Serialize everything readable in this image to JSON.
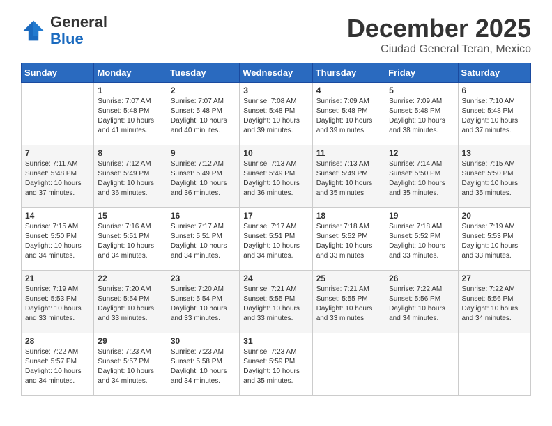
{
  "header": {
    "logo_general": "General",
    "logo_blue": "Blue",
    "month": "December 2025",
    "location": "Ciudad General Teran, Mexico"
  },
  "days_of_week": [
    "Sunday",
    "Monday",
    "Tuesday",
    "Wednesday",
    "Thursday",
    "Friday",
    "Saturday"
  ],
  "weeks": [
    [
      {
        "day": "",
        "info": ""
      },
      {
        "day": "1",
        "info": "Sunrise: 7:07 AM\nSunset: 5:48 PM\nDaylight: 10 hours\nand 41 minutes."
      },
      {
        "day": "2",
        "info": "Sunrise: 7:07 AM\nSunset: 5:48 PM\nDaylight: 10 hours\nand 40 minutes."
      },
      {
        "day": "3",
        "info": "Sunrise: 7:08 AM\nSunset: 5:48 PM\nDaylight: 10 hours\nand 39 minutes."
      },
      {
        "day": "4",
        "info": "Sunrise: 7:09 AM\nSunset: 5:48 PM\nDaylight: 10 hours\nand 39 minutes."
      },
      {
        "day": "5",
        "info": "Sunrise: 7:09 AM\nSunset: 5:48 PM\nDaylight: 10 hours\nand 38 minutes."
      },
      {
        "day": "6",
        "info": "Sunrise: 7:10 AM\nSunset: 5:48 PM\nDaylight: 10 hours\nand 37 minutes."
      }
    ],
    [
      {
        "day": "7",
        "info": "Sunrise: 7:11 AM\nSunset: 5:48 PM\nDaylight: 10 hours\nand 37 minutes."
      },
      {
        "day": "8",
        "info": "Sunrise: 7:12 AM\nSunset: 5:49 PM\nDaylight: 10 hours\nand 36 minutes."
      },
      {
        "day": "9",
        "info": "Sunrise: 7:12 AM\nSunset: 5:49 PM\nDaylight: 10 hours\nand 36 minutes."
      },
      {
        "day": "10",
        "info": "Sunrise: 7:13 AM\nSunset: 5:49 PM\nDaylight: 10 hours\nand 36 minutes."
      },
      {
        "day": "11",
        "info": "Sunrise: 7:13 AM\nSunset: 5:49 PM\nDaylight: 10 hours\nand 35 minutes."
      },
      {
        "day": "12",
        "info": "Sunrise: 7:14 AM\nSunset: 5:50 PM\nDaylight: 10 hours\nand 35 minutes."
      },
      {
        "day": "13",
        "info": "Sunrise: 7:15 AM\nSunset: 5:50 PM\nDaylight: 10 hours\nand 35 minutes."
      }
    ],
    [
      {
        "day": "14",
        "info": "Sunrise: 7:15 AM\nSunset: 5:50 PM\nDaylight: 10 hours\nand 34 minutes."
      },
      {
        "day": "15",
        "info": "Sunrise: 7:16 AM\nSunset: 5:51 PM\nDaylight: 10 hours\nand 34 minutes."
      },
      {
        "day": "16",
        "info": "Sunrise: 7:17 AM\nSunset: 5:51 PM\nDaylight: 10 hours\nand 34 minutes."
      },
      {
        "day": "17",
        "info": "Sunrise: 7:17 AM\nSunset: 5:51 PM\nDaylight: 10 hours\nand 34 minutes."
      },
      {
        "day": "18",
        "info": "Sunrise: 7:18 AM\nSunset: 5:52 PM\nDaylight: 10 hours\nand 33 minutes."
      },
      {
        "day": "19",
        "info": "Sunrise: 7:18 AM\nSunset: 5:52 PM\nDaylight: 10 hours\nand 33 minutes."
      },
      {
        "day": "20",
        "info": "Sunrise: 7:19 AM\nSunset: 5:53 PM\nDaylight: 10 hours\nand 33 minutes."
      }
    ],
    [
      {
        "day": "21",
        "info": "Sunrise: 7:19 AM\nSunset: 5:53 PM\nDaylight: 10 hours\nand 33 minutes."
      },
      {
        "day": "22",
        "info": "Sunrise: 7:20 AM\nSunset: 5:54 PM\nDaylight: 10 hours\nand 33 minutes."
      },
      {
        "day": "23",
        "info": "Sunrise: 7:20 AM\nSunset: 5:54 PM\nDaylight: 10 hours\nand 33 minutes."
      },
      {
        "day": "24",
        "info": "Sunrise: 7:21 AM\nSunset: 5:55 PM\nDaylight: 10 hours\nand 33 minutes."
      },
      {
        "day": "25",
        "info": "Sunrise: 7:21 AM\nSunset: 5:55 PM\nDaylight: 10 hours\nand 33 minutes."
      },
      {
        "day": "26",
        "info": "Sunrise: 7:22 AM\nSunset: 5:56 PM\nDaylight: 10 hours\nand 34 minutes."
      },
      {
        "day": "27",
        "info": "Sunrise: 7:22 AM\nSunset: 5:56 PM\nDaylight: 10 hours\nand 34 minutes."
      }
    ],
    [
      {
        "day": "28",
        "info": "Sunrise: 7:22 AM\nSunset: 5:57 PM\nDaylight: 10 hours\nand 34 minutes."
      },
      {
        "day": "29",
        "info": "Sunrise: 7:23 AM\nSunset: 5:57 PM\nDaylight: 10 hours\nand 34 minutes."
      },
      {
        "day": "30",
        "info": "Sunrise: 7:23 AM\nSunset: 5:58 PM\nDaylight: 10 hours\nand 34 minutes."
      },
      {
        "day": "31",
        "info": "Sunrise: 7:23 AM\nSunset: 5:59 PM\nDaylight: 10 hours\nand 35 minutes."
      },
      {
        "day": "",
        "info": ""
      },
      {
        "day": "",
        "info": ""
      },
      {
        "day": "",
        "info": ""
      }
    ]
  ]
}
